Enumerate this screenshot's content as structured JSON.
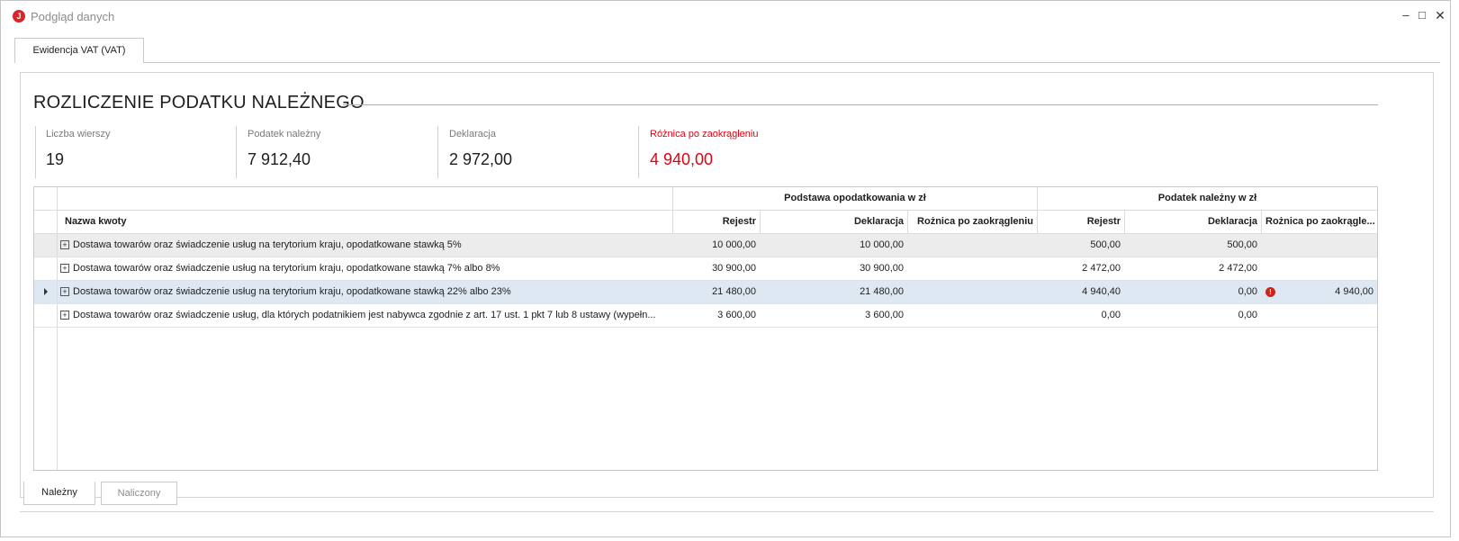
{
  "window": {
    "title": "Podgląd danych",
    "icon": "app-logo-icon",
    "controls": {
      "minimize": "–",
      "maximize": "□",
      "close": "✕"
    }
  },
  "tabs": {
    "top": [
      "Ewidencja VAT (VAT)"
    ],
    "bottom": [
      "Należny",
      "Naliczony"
    ],
    "bottom_active": "Należny"
  },
  "section": {
    "title": "ROZLICZENIE PODATKU NALEŻNEGO"
  },
  "stats": [
    {
      "label": "Liczba wierszy",
      "value": "19"
    },
    {
      "label": "Podatek należny",
      "value": "7 912,40"
    },
    {
      "label": "Deklaracja",
      "value": "2 972,00"
    },
    {
      "label": "Różnica po zaokrągleniu",
      "value": "4 940,00",
      "color": "#e3000f"
    }
  ],
  "grid": {
    "bands": [
      "Podstawa opodatkowania w zł",
      "Podatek należny w zł"
    ],
    "columns": [
      "Nazwa kwoty",
      "Rejestr",
      "Deklaracja",
      "Rożnica po zaokrągleniu",
      "Rejestr",
      "Deklaracja",
      "Rożnica po zaokrągle..."
    ],
    "rows": [
      {
        "name": "Dostawa towarów oraz świadczenie usług na terytorium kraju, opodatkowane stawką 5%",
        "base_rej": "10 000,00",
        "base_dek": "10 000,00",
        "base_diff": "",
        "tax_rej": "500,00",
        "tax_dek": "500,00",
        "tax_diff": ""
      },
      {
        "name": "Dostawa towarów oraz świadczenie usług na terytorium kraju, opodatkowane stawką 7% albo 8%",
        "base_rej": "30 900,00",
        "base_dek": "30 900,00",
        "base_diff": "",
        "tax_rej": "2 472,00",
        "tax_dek": "2 472,00",
        "tax_diff": ""
      },
      {
        "name": "Dostawa towarów oraz świadczenie usług na terytorium kraju, opodatkowane stawką 22% albo 23%",
        "base_rej": "21 480,00",
        "base_dek": "21 480,00",
        "base_diff": "",
        "tax_rej": "4 940,40",
        "tax_dek": "0,00",
        "tax_diff": "4 940,00",
        "warning": true,
        "selected": true
      },
      {
        "name": "Dostawa towarów oraz świadczenie usług, dla których podatnikiem jest nabywca zgodnie z art. 17 ust. 1 pkt 7 lub 8 ustawy (wypełn...",
        "base_rej": "3 600,00",
        "base_dek": "3 600,00",
        "base_diff": "",
        "tax_rej": "0,00",
        "tax_dek": "0,00",
        "tax_diff": ""
      }
    ],
    "colors": {
      "selected_row": "#dde8f3",
      "alt_row": "#ececec",
      "warning": "#c8281c"
    }
  }
}
